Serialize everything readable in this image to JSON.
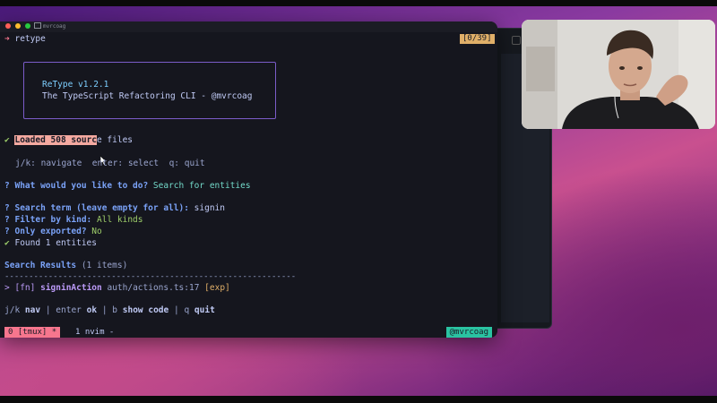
{
  "window": {
    "title": "mvrcoag"
  },
  "terminal": {
    "command": "retype",
    "counter": "[0/39]",
    "banner": {
      "name": "ReType v1.2.1",
      "subtitle": "The TypeScript Refactoring CLI - @mvrcoag"
    },
    "loaded": {
      "check": "✔",
      "highlight": "Loaded 508 sourc",
      "rest": "e files"
    },
    "keys_hint": "j/k: navigate  enter: select  q: quit",
    "q1": {
      "mark": "?",
      "question": "What would you like to do?",
      "answer": "Search for entities"
    },
    "q2": {
      "mark": "?",
      "question": "Search term (leave empty for all):",
      "answer": "signin"
    },
    "q3": {
      "mark": "?",
      "question": "Filter by kind:",
      "answer": "All kinds"
    },
    "q4": {
      "mark": "?",
      "question": "Only exported?",
      "answer": "No"
    },
    "found": {
      "check": "✔",
      "text": "Found 1 entities"
    },
    "results": {
      "title": "Search Results",
      "count": "(1 items)"
    },
    "separator": "------------------------------------------------------------",
    "result_item": {
      "cursor": ">",
      "kind": "[fn]",
      "name": "signinAction",
      "path": "auth/actions.ts:17",
      "tag": "[exp]"
    },
    "footer_keys": [
      {
        "key": "j/k",
        "label": "nav"
      },
      {
        "key": "enter",
        "label": "ok"
      },
      {
        "key": "b",
        "label": "show code"
      },
      {
        "key": "q",
        "label": "quit"
      }
    ],
    "footer_sep": "|"
  },
  "statusbar": {
    "session": "0 [tmux] *",
    "window": "1 nvim -",
    "handle": "@mvrcoag"
  },
  "colors": {
    "accent": "#7aa2f7",
    "highlight": "#f4a9a0",
    "status_session": "#f7768e",
    "status_handle": "#2ac3a2"
  }
}
